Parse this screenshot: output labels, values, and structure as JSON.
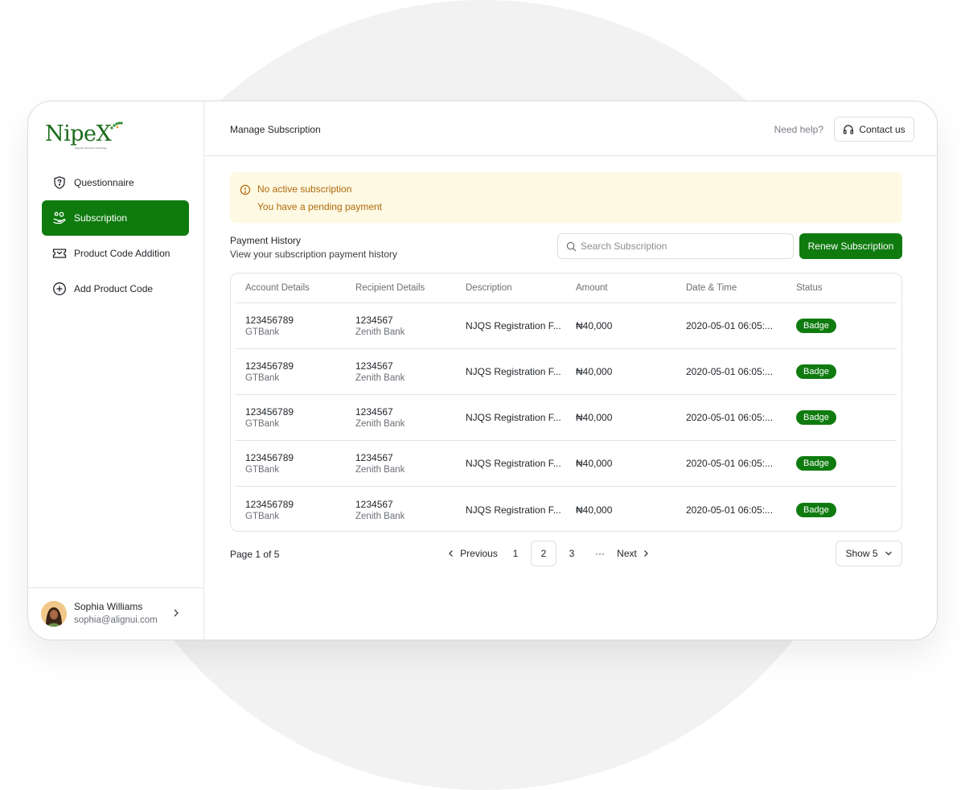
{
  "brand": {
    "logo_text": "NipeX",
    "logo_tagline": "Nigerian Petroleum Exchange"
  },
  "sidebar": {
    "items": [
      {
        "label": "Questionnaire",
        "icon": "shield-question-icon",
        "active": false
      },
      {
        "label": "Subscription",
        "icon": "hand-coins-icon",
        "active": true
      },
      {
        "label": "Product Code Addition",
        "icon": "ticket-icon",
        "active": false
      },
      {
        "label": "Add Product Code",
        "icon": "plus-circle-icon",
        "active": false
      }
    ],
    "user": {
      "name": "Sophia Williams",
      "email": "sophia@alignui.com"
    }
  },
  "header": {
    "title": "Manage Subscription",
    "help_text": "Need help?",
    "contact_label": "Contact us"
  },
  "alert": {
    "line1": "No active subscription",
    "line2": "You have a pending payment",
    "color": "#b06a0b"
  },
  "payment_history": {
    "title": "Payment History",
    "subtitle": "View your subscription payment history",
    "search_placeholder": "Search Subscription",
    "renew_label": "Renew Subscription"
  },
  "table": {
    "columns": [
      "Account Details",
      "Recipient Details",
      "Description",
      "Amount",
      "Date & Time",
      "Status"
    ],
    "rows": [
      {
        "account": "123456789",
        "account_bank": "GTBank",
        "recipient": "1234567",
        "recipient_bank": "Zenith Bank",
        "description": "NJQS Registration F...",
        "amount": "₦40,000",
        "datetime": "2020-05-01 06:05:...",
        "status": "Badge"
      },
      {
        "account": "123456789",
        "account_bank": "GTBank",
        "recipient": "1234567",
        "recipient_bank": "Zenith Bank",
        "description": "NJQS Registration F...",
        "amount": "₦40,000",
        "datetime": "2020-05-01 06:05:...",
        "status": "Badge"
      },
      {
        "account": "123456789",
        "account_bank": "GTBank",
        "recipient": "1234567",
        "recipient_bank": "Zenith Bank",
        "description": "NJQS Registration F...",
        "amount": "₦40,000",
        "datetime": "2020-05-01 06:05:...",
        "status": "Badge"
      },
      {
        "account": "123456789",
        "account_bank": "GTBank",
        "recipient": "1234567",
        "recipient_bank": "Zenith Bank",
        "description": "NJQS Registration F...",
        "amount": "₦40,000",
        "datetime": "2020-05-01 06:05:...",
        "status": "Badge"
      },
      {
        "account": "123456789",
        "account_bank": "GTBank",
        "recipient": "1234567",
        "recipient_bank": "Zenith Bank",
        "description": "NJQS Registration F...",
        "amount": "₦40,000",
        "datetime": "2020-05-01 06:05:...",
        "status": "Badge"
      }
    ]
  },
  "pagination": {
    "page_info": "Page 1 of 5",
    "previous_label": "Previous",
    "pages": [
      "1",
      "2",
      "3"
    ],
    "current_page": "2",
    "ellipsis": "···",
    "next_label": "Next",
    "show_label": "Show 5"
  },
  "colors": {
    "accent": "#0f7b0f",
    "alert_bg": "#fdf9e3"
  }
}
